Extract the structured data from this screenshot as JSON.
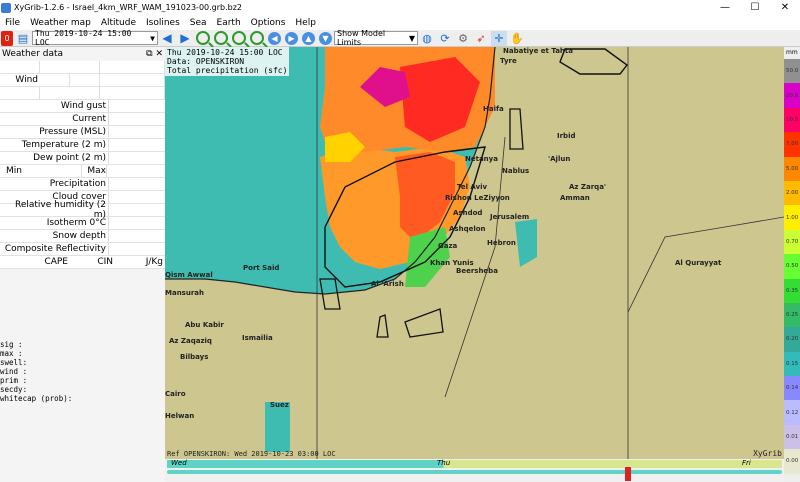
{
  "window": {
    "title": "XyGrib-1.2.6 - Israel_4km_WRF_WAM_191023-00.grb.bz2",
    "minimize": "—",
    "maximize": "☐",
    "close": "✕"
  },
  "menu": [
    "File",
    "Weather map",
    "Altitude",
    "Isolines",
    "Sea",
    "Earth",
    "Options",
    "Help"
  ],
  "toolbar": {
    "date_value": "Thu 2019-10-24 15:00 LOC",
    "date_dropdown_icon": "▼",
    "model_limits": "Show Model Limits",
    "model_dropdown_icon": "▼"
  },
  "weather_panel": {
    "title": "Weather data",
    "rows": [
      {
        "label": "Wind gust"
      },
      {
        "label": "Current"
      },
      {
        "label": "Pressure (MSL)"
      },
      {
        "label": "Temperature (2 m)"
      },
      {
        "label": "Dew point (2 m)"
      },
      {
        "label": "Precipitation"
      },
      {
        "label": "Cloud cover"
      },
      {
        "label": "Relative humidity (2 m)"
      },
      {
        "label": "Isotherm 0°C"
      },
      {
        "label": "Snow depth"
      },
      {
        "label": "Composite Reflectivity"
      }
    ],
    "wind_label": "Wind",
    "min_label": "Min",
    "max_label": "Max",
    "cape_label": "CAPE",
    "cin_label": "CIN",
    "jkg_label": "J/Kg",
    "info_lines": [
      "sig  :",
      "max  :",
      "swell:",
      "wind :",
      "prim :",
      "secdy:",
      "whitecap (prob):"
    ]
  },
  "map": {
    "header_lines": [
      "Thu 2019-10-24 15:00 LOC",
      "Data: OPENSKIRON",
      "Total precipitation (sfc)"
    ],
    "footer": "Ref OPENSKIRON: Wed 2019-10-23 03:00 LOC",
    "brand": "XyGrib",
    "places": [
      {
        "name": "Nabatiye et Tahta"
      },
      {
        "name": "Tyre"
      },
      {
        "name": "Haifa"
      },
      {
        "name": "Irbid"
      },
      {
        "name": "Netanya"
      },
      {
        "name": "'Ajlun"
      },
      {
        "name": "Nablus"
      },
      {
        "name": "Az Zarqa'"
      },
      {
        "name": "Tel Aviv"
      },
      {
        "name": "Amman"
      },
      {
        "name": "Rishon LeZiyyon"
      },
      {
        "name": "Ashdod"
      },
      {
        "name": "Jerusalem"
      },
      {
        "name": "Ashqelon"
      },
      {
        "name": "Gaza"
      },
      {
        "name": "Hebron"
      },
      {
        "name": "Khan Yunis"
      },
      {
        "name": "Beersheba"
      },
      {
        "name": "Port Said"
      },
      {
        "name": "Qism Awwal"
      },
      {
        "name": "Al 'Arish"
      },
      {
        "name": "Al Qurayyat"
      },
      {
        "name": "Mansurah"
      },
      {
        "name": "Abu Kabir"
      },
      {
        "name": "Az Zaqaziq"
      },
      {
        "name": "Ismailia"
      },
      {
        "name": "Bilbays"
      },
      {
        "name": "Suez"
      },
      {
        "name": "Cairo"
      },
      {
        "name": "Helwan"
      }
    ]
  },
  "timeline": {
    "day1": "Wed",
    "day2": "Thu",
    "day3": "Fri",
    "position_fraction": 0.75
  },
  "legend": {
    "unit": "mm",
    "values": [
      "50.0",
      "20.0",
      "10.0",
      "7.00",
      "5.00",
      "2.00",
      "1.00",
      "0.70",
      "0.50",
      "0.35",
      "0.25",
      "0.20",
      "0.15",
      "0.14",
      "0.12",
      "0.01",
      "0.00"
    ],
    "colors": [
      "#909090",
      "#d900c8",
      "#ff0066",
      "#ff3300",
      "#ff8800",
      "#ffbb00",
      "#ffee00",
      "#ccff33",
      "#66ff33",
      "#33dd33",
      "#33bb66",
      "#33aa99",
      "#33bbbb",
      "#8888ff",
      "#bbbbff",
      "#ccc0e8",
      "#e8e8d0"
    ]
  },
  "colors": {
    "sea": "#3fbcb2",
    "land": "#cdc68f",
    "rain_core": "#ff3300",
    "rain_mid": "#ff9a2a"
  }
}
